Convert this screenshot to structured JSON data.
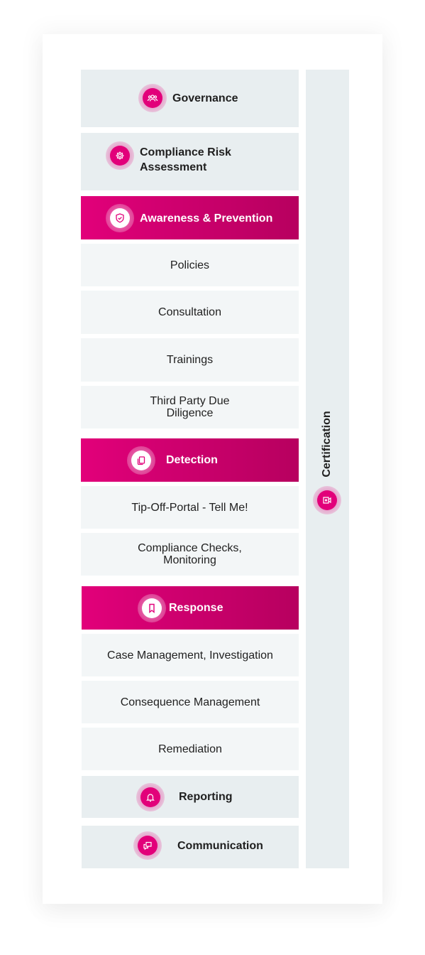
{
  "diagram": {
    "accent_color": "#e2007a",
    "sections": [
      {
        "id": "governance",
        "label": "Governance",
        "icon": "people-group-icon",
        "style": "section"
      },
      {
        "id": "risk",
        "label": "Compliance Risk Assessment",
        "label_lines": [
          "Compliance Risk",
          "Assessment"
        ],
        "icon": "gear-icon",
        "style": "section"
      },
      {
        "id": "awareness",
        "label": "Awareness & Prevention",
        "icon": "shield-check-icon",
        "style": "header",
        "items": [
          "Policies",
          "Consultation",
          "Trainings",
          "Third Party Due Diligence"
        ]
      },
      {
        "id": "detection",
        "label": "Detection",
        "icon": "documents-icon",
        "style": "header",
        "items": [
          "Tip-Off-Portal - Tell Me!",
          "Compliance Checks, Monitoring"
        ]
      },
      {
        "id": "response",
        "label": "Response",
        "icon": "bookmark-icon",
        "style": "header",
        "items": [
          "Case Management, Investigation",
          "Consequence Management",
          "Remediation"
        ]
      },
      {
        "id": "reporting",
        "label": "Reporting",
        "icon": "bell-icon",
        "style": "section"
      },
      {
        "id": "communication",
        "label": "Communication",
        "icon": "chat-bubbles-icon",
        "style": "section"
      }
    ],
    "sidebar": {
      "label": "Certification",
      "icon": "certificate-video-icon"
    },
    "item_lines": {
      "third_party": [
        "Third Party Due",
        "Diligence"
      ],
      "checks": [
        "Compliance Checks,",
        "Monitoring"
      ]
    }
  }
}
